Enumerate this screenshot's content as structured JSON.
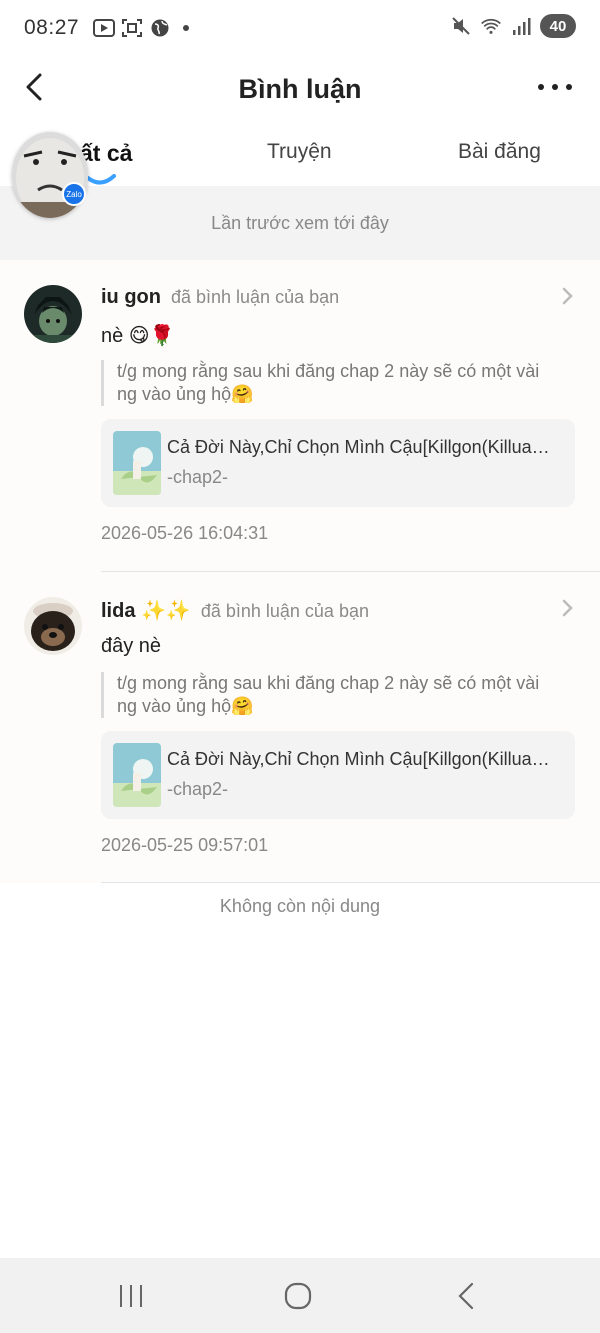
{
  "status_bar": {
    "time": "08:27",
    "battery": "40",
    "icons": [
      "video-app-icon",
      "screenshot-icon",
      "globe-icon",
      "mute-icon",
      "wifi-icon",
      "signal-icon"
    ]
  },
  "header": {
    "title": "Bình luận"
  },
  "tabs": [
    {
      "label": "Tất cả",
      "visible_label": "ất cả",
      "active": true
    },
    {
      "label": "Truyện",
      "active": false
    },
    {
      "label": "Bài đăng",
      "active": false
    }
  ],
  "floating_bubble": {
    "badge": "Zalo"
  },
  "banner": {
    "text": "Lần trước xem tới đây"
  },
  "comments": [
    {
      "user": "iu gon",
      "action": "đã bình luận của bạn",
      "text": "nè 😋🌹",
      "quote": "t/g mong rằng sau khi đăng chap 2 này sẽ có một vài ng vào ủng hộ🤗",
      "story_title": "Cả Đời Này,Chỉ Chọn Mình Cậu[Killgon(Killua…",
      "story_sub": "-chap2-",
      "time": "2026-05-26 16:04:31"
    },
    {
      "user": "lida ✨✨",
      "action": "đã bình luận của bạn",
      "text": "đây nè",
      "quote": "t/g mong rằng sau khi đăng chap 2 này sẽ có một vài ng vào ủng hộ🤗",
      "story_title": "Cả Đời Này,Chỉ Chọn Mình Cậu[Killgon(Killua…",
      "story_sub": "-chap2-",
      "time": "2026-05-25 09:57:01"
    }
  ],
  "footer": {
    "no_more": "Không còn nội dung"
  },
  "colors": {
    "accent": "#3aa0ff",
    "text": "#222222",
    "muted": "#888888"
  }
}
